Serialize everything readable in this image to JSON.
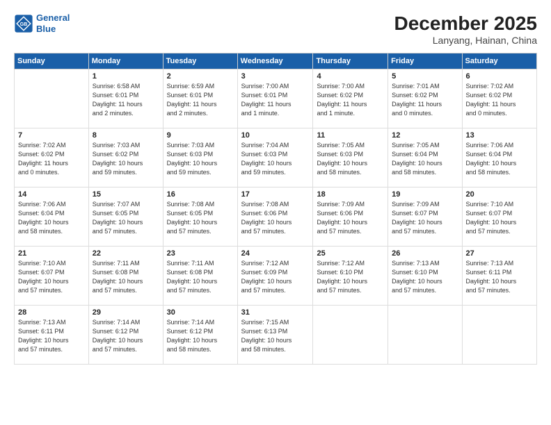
{
  "logo": {
    "line1": "General",
    "line2": "Blue"
  },
  "title": "December 2025",
  "subtitle": "Lanyang, Hainan, China",
  "days_header": [
    "Sunday",
    "Monday",
    "Tuesday",
    "Wednesday",
    "Thursday",
    "Friday",
    "Saturday"
  ],
  "weeks": [
    [
      {
        "num": "",
        "info": ""
      },
      {
        "num": "1",
        "info": "Sunrise: 6:58 AM\nSunset: 6:01 PM\nDaylight: 11 hours\nand 2 minutes."
      },
      {
        "num": "2",
        "info": "Sunrise: 6:59 AM\nSunset: 6:01 PM\nDaylight: 11 hours\nand 2 minutes."
      },
      {
        "num": "3",
        "info": "Sunrise: 7:00 AM\nSunset: 6:01 PM\nDaylight: 11 hours\nand 1 minute."
      },
      {
        "num": "4",
        "info": "Sunrise: 7:00 AM\nSunset: 6:02 PM\nDaylight: 11 hours\nand 1 minute."
      },
      {
        "num": "5",
        "info": "Sunrise: 7:01 AM\nSunset: 6:02 PM\nDaylight: 11 hours\nand 0 minutes."
      },
      {
        "num": "6",
        "info": "Sunrise: 7:02 AM\nSunset: 6:02 PM\nDaylight: 11 hours\nand 0 minutes."
      }
    ],
    [
      {
        "num": "7",
        "info": "Sunrise: 7:02 AM\nSunset: 6:02 PM\nDaylight: 11 hours\nand 0 minutes."
      },
      {
        "num": "8",
        "info": "Sunrise: 7:03 AM\nSunset: 6:02 PM\nDaylight: 10 hours\nand 59 minutes."
      },
      {
        "num": "9",
        "info": "Sunrise: 7:03 AM\nSunset: 6:03 PM\nDaylight: 10 hours\nand 59 minutes."
      },
      {
        "num": "10",
        "info": "Sunrise: 7:04 AM\nSunset: 6:03 PM\nDaylight: 10 hours\nand 59 minutes."
      },
      {
        "num": "11",
        "info": "Sunrise: 7:05 AM\nSunset: 6:03 PM\nDaylight: 10 hours\nand 58 minutes."
      },
      {
        "num": "12",
        "info": "Sunrise: 7:05 AM\nSunset: 6:04 PM\nDaylight: 10 hours\nand 58 minutes."
      },
      {
        "num": "13",
        "info": "Sunrise: 7:06 AM\nSunset: 6:04 PM\nDaylight: 10 hours\nand 58 minutes."
      }
    ],
    [
      {
        "num": "14",
        "info": "Sunrise: 7:06 AM\nSunset: 6:04 PM\nDaylight: 10 hours\nand 58 minutes."
      },
      {
        "num": "15",
        "info": "Sunrise: 7:07 AM\nSunset: 6:05 PM\nDaylight: 10 hours\nand 57 minutes."
      },
      {
        "num": "16",
        "info": "Sunrise: 7:08 AM\nSunset: 6:05 PM\nDaylight: 10 hours\nand 57 minutes."
      },
      {
        "num": "17",
        "info": "Sunrise: 7:08 AM\nSunset: 6:06 PM\nDaylight: 10 hours\nand 57 minutes."
      },
      {
        "num": "18",
        "info": "Sunrise: 7:09 AM\nSunset: 6:06 PM\nDaylight: 10 hours\nand 57 minutes."
      },
      {
        "num": "19",
        "info": "Sunrise: 7:09 AM\nSunset: 6:07 PM\nDaylight: 10 hours\nand 57 minutes."
      },
      {
        "num": "20",
        "info": "Sunrise: 7:10 AM\nSunset: 6:07 PM\nDaylight: 10 hours\nand 57 minutes."
      }
    ],
    [
      {
        "num": "21",
        "info": "Sunrise: 7:10 AM\nSunset: 6:07 PM\nDaylight: 10 hours\nand 57 minutes."
      },
      {
        "num": "22",
        "info": "Sunrise: 7:11 AM\nSunset: 6:08 PM\nDaylight: 10 hours\nand 57 minutes."
      },
      {
        "num": "23",
        "info": "Sunrise: 7:11 AM\nSunset: 6:08 PM\nDaylight: 10 hours\nand 57 minutes."
      },
      {
        "num": "24",
        "info": "Sunrise: 7:12 AM\nSunset: 6:09 PM\nDaylight: 10 hours\nand 57 minutes."
      },
      {
        "num": "25",
        "info": "Sunrise: 7:12 AM\nSunset: 6:10 PM\nDaylight: 10 hours\nand 57 minutes."
      },
      {
        "num": "26",
        "info": "Sunrise: 7:13 AM\nSunset: 6:10 PM\nDaylight: 10 hours\nand 57 minutes."
      },
      {
        "num": "27",
        "info": "Sunrise: 7:13 AM\nSunset: 6:11 PM\nDaylight: 10 hours\nand 57 minutes."
      }
    ],
    [
      {
        "num": "28",
        "info": "Sunrise: 7:13 AM\nSunset: 6:11 PM\nDaylight: 10 hours\nand 57 minutes."
      },
      {
        "num": "29",
        "info": "Sunrise: 7:14 AM\nSunset: 6:12 PM\nDaylight: 10 hours\nand 57 minutes."
      },
      {
        "num": "30",
        "info": "Sunrise: 7:14 AM\nSunset: 6:12 PM\nDaylight: 10 hours\nand 58 minutes."
      },
      {
        "num": "31",
        "info": "Sunrise: 7:15 AM\nSunset: 6:13 PM\nDaylight: 10 hours\nand 58 minutes."
      },
      {
        "num": "",
        "info": ""
      },
      {
        "num": "",
        "info": ""
      },
      {
        "num": "",
        "info": ""
      }
    ]
  ]
}
